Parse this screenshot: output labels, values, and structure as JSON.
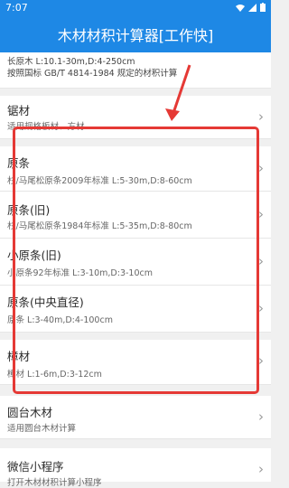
{
  "statusbar": {
    "time": "7:07"
  },
  "appbar": {
    "title": "木材材积计算器[工作快]"
  },
  "top_card": {
    "line1": "长原木 L:10.1-30m,D:4-250cm",
    "line2": "按照国标 GB/T 4814-1984 规定的材积计算"
  },
  "items": [
    {
      "title": "锯材",
      "subtitle": "适用规格板材、方材"
    },
    {
      "title": "原条",
      "subtitle": "杉/马尾松原条2009年标准 L:5-30m,D:8-60cm"
    },
    {
      "title": "原条(旧)",
      "subtitle": "杉/马尾松原条1984年标准 L:5-35m,D:8-80cm"
    },
    {
      "title": "小原条(旧)",
      "subtitle": "小原条92年标准 L:3-10m,D:3-10cm"
    },
    {
      "title": "原条(中央直径)",
      "subtitle": "原条 L:3-40m,D:4-100cm"
    },
    {
      "title": "樟材",
      "subtitle": "樟材 L:1-6m,D:3-12cm"
    },
    {
      "title": "圆台木材",
      "subtitle": "适用圆台木材计算"
    },
    {
      "title": "微信小程序",
      "subtitle": "打开木材材积计算小程序"
    }
  ],
  "colors": {
    "primary": "#1e88e5",
    "highlight": "#e53935"
  }
}
